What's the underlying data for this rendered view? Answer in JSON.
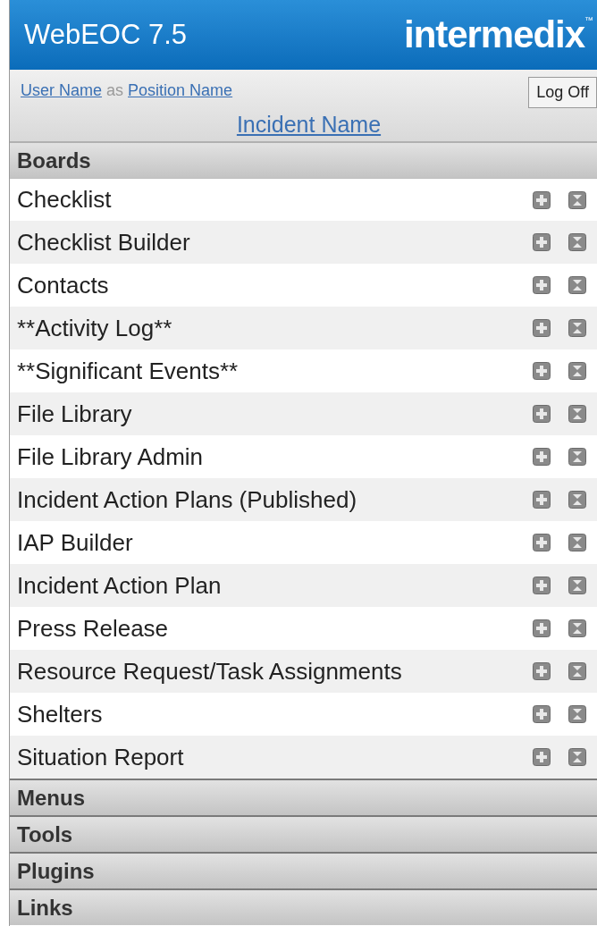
{
  "header": {
    "title": "WebEOC 7.5",
    "logo": "intermedix",
    "trademark": "™"
  },
  "user_bar": {
    "user": "User Name",
    "connector": "as",
    "position": "Position Name",
    "logoff": "Log Off",
    "incident": "Incident Name"
  },
  "sections": [
    {
      "label": "Boards",
      "expanded": true,
      "items": [
        {
          "label": "Checklist"
        },
        {
          "label": "Checklist Builder"
        },
        {
          "label": "Contacts"
        },
        {
          "label": "**Activity Log**"
        },
        {
          "label": "**Significant Events**"
        },
        {
          "label": "File Library"
        },
        {
          "label": "File Library Admin"
        },
        {
          "label": "Incident Action Plans (Published)"
        },
        {
          "label": "IAP Builder"
        },
        {
          "label": "Incident Action Plan"
        },
        {
          "label": "Press Release"
        },
        {
          "label": "Resource Request/Task Assignments"
        },
        {
          "label": "Shelters"
        },
        {
          "label": "Situation Report"
        }
      ]
    },
    {
      "label": "Menus",
      "expanded": false
    },
    {
      "label": "Tools",
      "expanded": false
    },
    {
      "label": "Plugins",
      "expanded": false
    },
    {
      "label": "Links",
      "expanded": false
    }
  ]
}
